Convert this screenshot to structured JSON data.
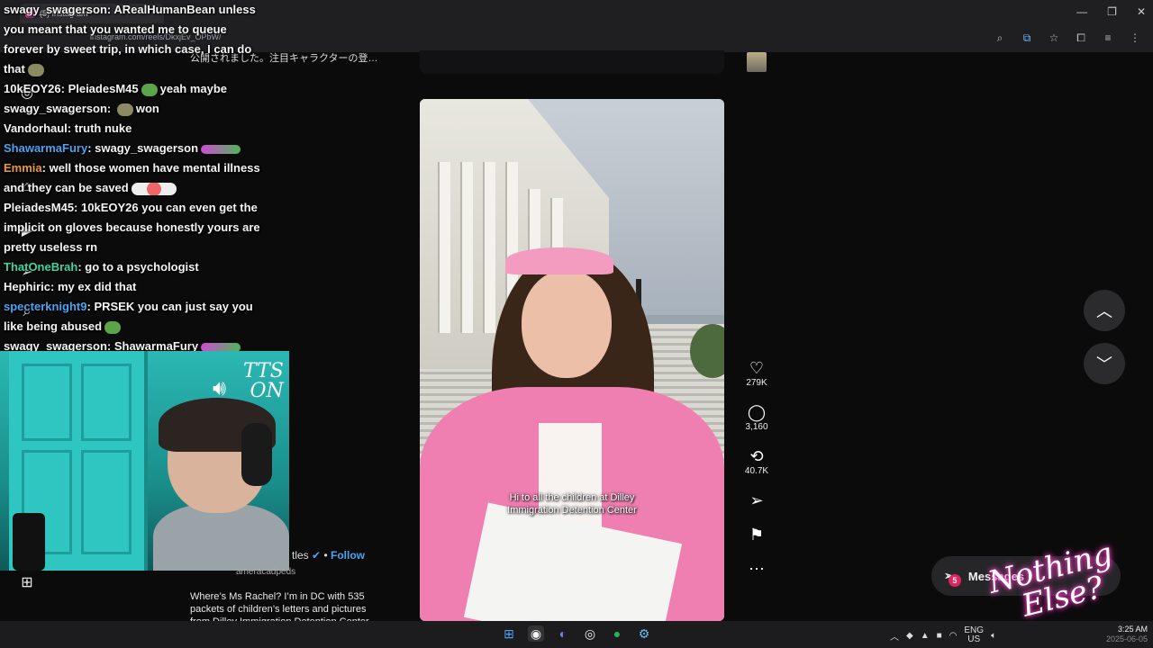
{
  "browser": {
    "tab_title": "(5) Instagram",
    "url": "instagram.com/reels/DkxjEv_OPbW/",
    "win_minimize": "—",
    "win_restore": "❐",
    "win_close": "✕"
  },
  "page": {
    "jp_snippet": "公開されました。注目キャラクターの登…"
  },
  "chat": [
    {
      "user": "swagy_swagerson",
      "user_color": "default",
      "text": "ARealHumanBean unless you meant that you wanted me to queue forever by sweet trip, in which case, I can do that",
      "emote": "rock"
    },
    {
      "user": "10kEOY26",
      "user_color": "default",
      "text": "PleiadesM45",
      "emote": "pepe",
      "after": "yeah maybe"
    },
    {
      "user": "swagy_swagerson",
      "user_color": "default",
      "text": "",
      "emote": "rock",
      "after": "won"
    },
    {
      "user": "Vandorhaul",
      "user_color": "default",
      "text": "truth nuke"
    },
    {
      "user": "ShawarmaFury",
      "user_color": "blue",
      "text": "swagy_swagerson",
      "emote": "car"
    },
    {
      "user": "Emmia",
      "user_color": "orange",
      "text": "well those women have mental illness and they can be saved",
      "emote": "wing"
    },
    {
      "user": "PleiadesM45",
      "user_color": "default",
      "text": "10kEOY26 you can even get the implicit on gloves because honestly yours are pretty useless rn"
    },
    {
      "user": "ThatOneBrah",
      "user_color": "green",
      "text": "go to a psychologist"
    },
    {
      "user": "Hephiric",
      "user_color": "default",
      "text": "my ex did that"
    },
    {
      "user": "specterknight9",
      "user_color": "blue",
      "text": "PRSEK you can just say you like being abused",
      "emote": "pepe"
    },
    {
      "user": "swagy_swagerson",
      "user_color": "default",
      "text": "ShawarmaFury",
      "emote": "car"
    }
  ],
  "webcam": {
    "tts_line1": "TTS",
    "tts_line2": "ON"
  },
  "post": {
    "author_partial": "tles",
    "follow_label": "Follow",
    "handle": "ameracadpeds",
    "caption": "Where’s Ms Rachel? I’m in DC with 535 packets of children’s letters and pictures from Dilley Immigration Detention Center",
    "subtitle_line1": "Hi to all the children at Dilley",
    "subtitle_line2": "Immigration Detention Center"
  },
  "actions": {
    "likes": "279K",
    "comments": "3,160",
    "reposts": "40.7K"
  },
  "messages": {
    "label": "Messages",
    "badge": "5"
  },
  "overlay": {
    "neon_line1": "Nothing",
    "neon_line2": "Else?"
  },
  "taskbar": {
    "lang_line1": "ENG",
    "lang_line2": "US",
    "time": "3:25 AM",
    "date": "2025-06-05"
  }
}
